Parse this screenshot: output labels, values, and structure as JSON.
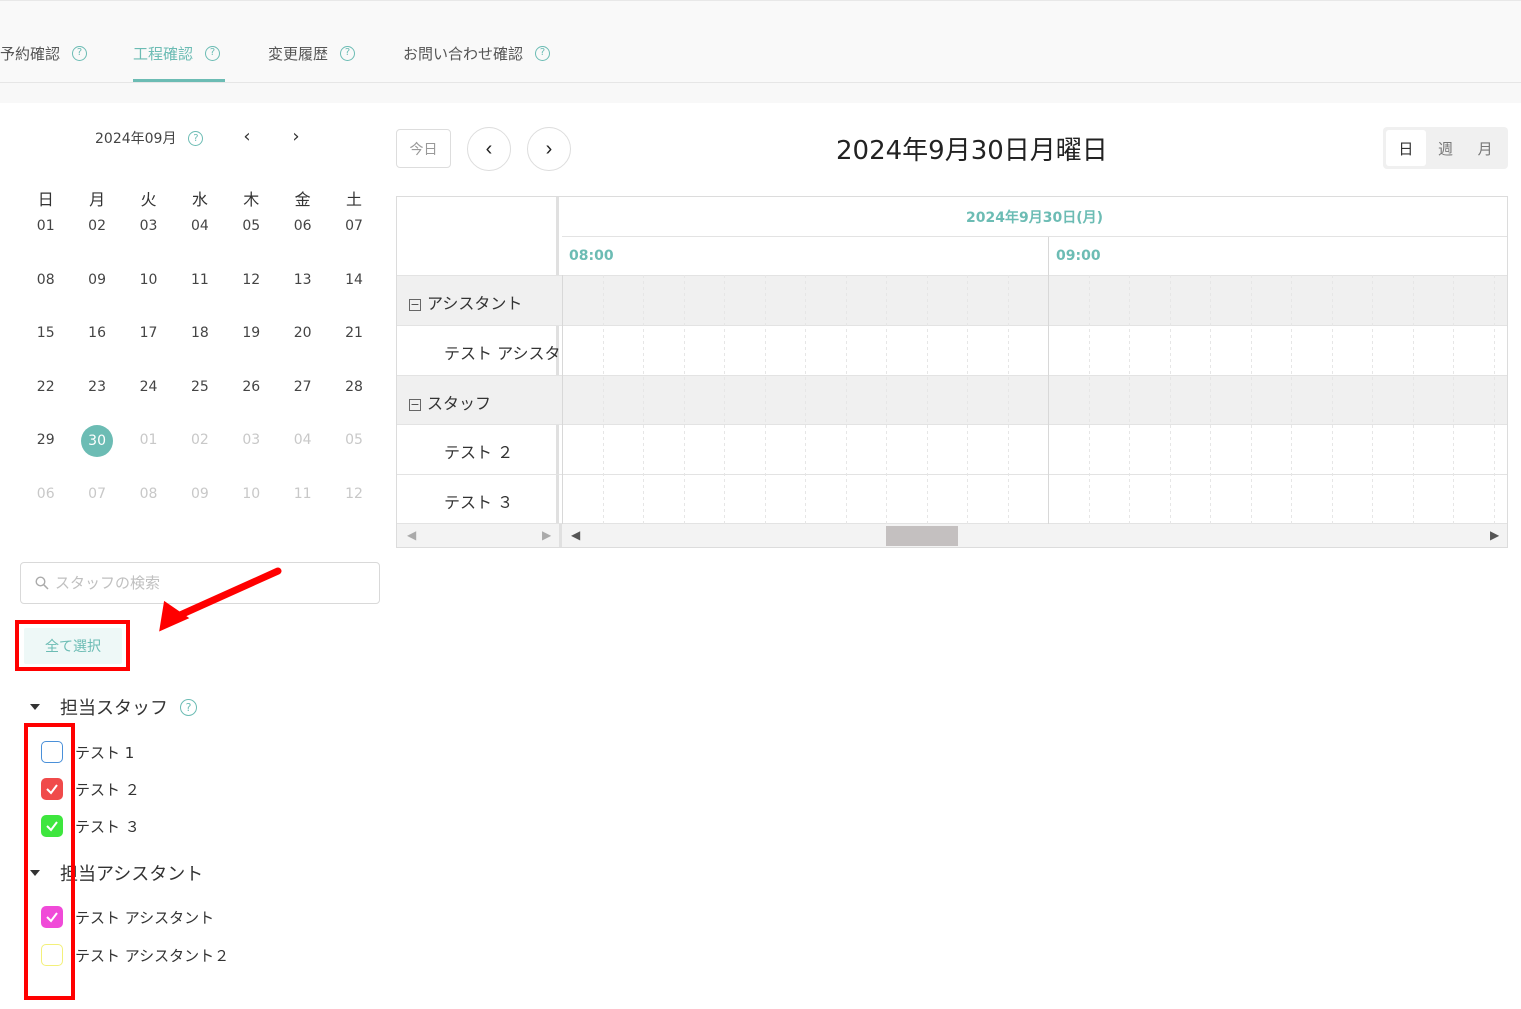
{
  "tabs": [
    {
      "label": "予約確認",
      "active": false
    },
    {
      "label": "工程確認",
      "active": true
    },
    {
      "label": "変更履歴",
      "active": false
    },
    {
      "label": "お問い合わせ確認",
      "active": false
    }
  ],
  "help_icon": "?",
  "mini_calendar": {
    "month_label": "2024年09月",
    "prev": "‹",
    "next": "›",
    "weekdays": [
      "日",
      "月",
      "火",
      "水",
      "木",
      "金",
      "土"
    ],
    "weeks": [
      [
        "01",
        "02",
        "03",
        "04",
        "05",
        "06",
        "07"
      ],
      [
        "08",
        "09",
        "10",
        "11",
        "12",
        "13",
        "14"
      ],
      [
        "15",
        "16",
        "17",
        "18",
        "19",
        "20",
        "21"
      ],
      [
        "22",
        "23",
        "24",
        "25",
        "26",
        "27",
        "28"
      ],
      [
        "29",
        "30",
        "01",
        "02",
        "03",
        "04",
        "05"
      ],
      [
        "06",
        "07",
        "08",
        "09",
        "10",
        "11",
        "12"
      ]
    ],
    "selected": "30"
  },
  "search": {
    "placeholder": "スタッフの検索",
    "icon": "search-icon"
  },
  "select_all_label": "全て選択",
  "groups": [
    {
      "title": "担当スタッフ",
      "has_help": true,
      "items": [
        {
          "label": "テスト 1",
          "checked": false,
          "color": "#4a90d9"
        },
        {
          "label": "テスト ２",
          "checked": true,
          "color": "#f04a4a"
        },
        {
          "label": "テスト ３",
          "checked": true,
          "color": "#3ee63e"
        }
      ]
    },
    {
      "title": "担当アシスタント",
      "has_help": false,
      "items": [
        {
          "label": "テスト アシスタント",
          "checked": true,
          "color": "#f04ad8"
        },
        {
          "label": "テスト アシスタント２",
          "checked": false,
          "color": "#f3f07a"
        }
      ]
    }
  ],
  "toolbar": {
    "today": "今日",
    "prev": "‹",
    "next": "›",
    "title": "2024年9月30日月曜日",
    "views": [
      "日",
      "週",
      "月"
    ],
    "active_view": "日"
  },
  "scheduler": {
    "date_header": "2024年9月30日(月)",
    "times": [
      "08:00",
      "09:00"
    ],
    "rows": [
      {
        "label": "アシスタント",
        "group": true
      },
      {
        "label": "テスト アシスタント",
        "group": false
      },
      {
        "label": "スタッフ",
        "group": true
      },
      {
        "label": "テスト ２",
        "group": false
      },
      {
        "label": "テスト ３",
        "group": false
      }
    ]
  },
  "colors": {
    "accent": "#6cbcb4",
    "annotation": "#ff0000"
  }
}
